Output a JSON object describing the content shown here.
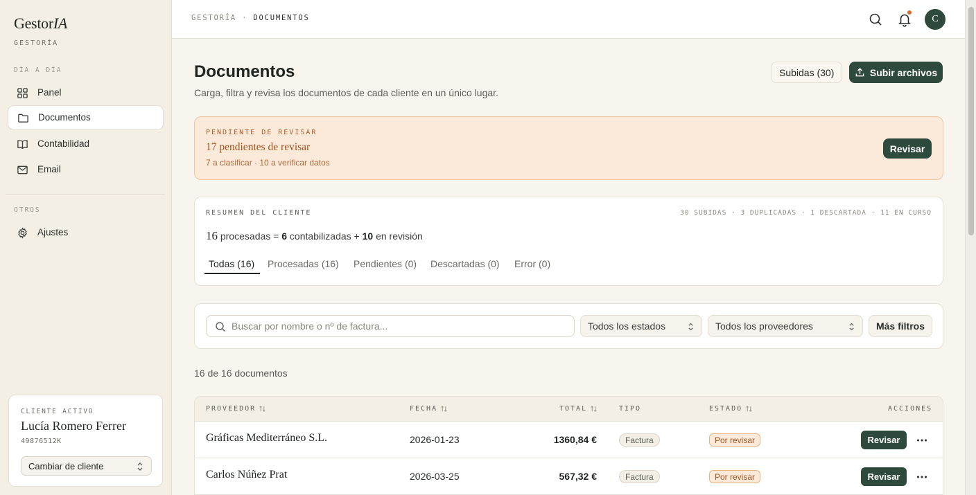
{
  "sidebar": {
    "brand_main": "Gestor",
    "brand_italic": "IA",
    "brand_sub": "GESTORÍA",
    "section_day": "DÍA A DÍA",
    "section_others": "OTROS",
    "items": [
      {
        "label": "Panel",
        "icon": "grid-icon"
      },
      {
        "label": "Documentos",
        "icon": "folder-icon",
        "active": true
      },
      {
        "label": "Contabilidad",
        "icon": "book-icon"
      },
      {
        "label": "Email",
        "icon": "mail-icon"
      },
      {
        "label": "Ajustes",
        "icon": "gear-icon"
      }
    ],
    "client": {
      "label": "CLIENTE ACTIVO",
      "name": "Lucía Romero Ferrer",
      "nif": "49876512K",
      "switch_label": "Cambiar de cliente"
    }
  },
  "topbar": {
    "crumb_root": "GESTORÍA",
    "crumb_sep": " · ",
    "crumb_current": "DOCUMENTOS",
    "avatar_initial": "C"
  },
  "header": {
    "title": "Documentos",
    "description": "Carga, filtra y revisa los documentos de cada cliente en un único lugar.",
    "uploads_button": "Subidas (30)",
    "upload_button": "Subir archivos"
  },
  "alert": {
    "label": "PENDIENTE DE REVISAR",
    "title": "17 pendientes de revisar",
    "subtitle": "7 a clasificar · 10 a verificar datos",
    "button": "Revisar"
  },
  "summary": {
    "label": "RESUMEN DEL CLIENTE",
    "stats": "30 SUBIDAS · 3 DUPLICADAS · 1 DESCARTADA · 11 EN CURSO",
    "processed": "16",
    "processed_text": " procesadas = ",
    "booked": "6",
    "booked_text": " contabilizadas + ",
    "review": "10",
    "review_text": " en revisión",
    "tabs": [
      "Todas (16)",
      "Procesadas (16)",
      "Pendientes (0)",
      "Descartadas (0)",
      "Error (0)"
    ]
  },
  "filters": {
    "search_placeholder": "Buscar por nombre o nº de factura...",
    "state_select": "Todos los estados",
    "provider_select": "Todos los proveedores",
    "more_button": "Más filtros"
  },
  "count_text": "16 de 16 documentos",
  "table": {
    "columns": {
      "provider": "PROVEEDOR",
      "date": "FECHA",
      "total": "TOTAL",
      "type": "TIPO",
      "state": "ESTADO",
      "actions": "ACCIONES"
    },
    "rows": [
      {
        "provider": "Gráficas Mediterráneo S.L.",
        "date": "2026-01-23",
        "total": "1360,84 €",
        "type": "Factura",
        "state": "Por revisar",
        "action": "Revisar"
      },
      {
        "provider": "Carlos Núñez Prat",
        "date": "2026-03-25",
        "total": "567,32 €",
        "type": "Factura",
        "state": "Por revisar",
        "action": "Revisar"
      }
    ]
  },
  "colors": {
    "accent": "#2e4a3c",
    "warning_bg": "#fbe9da",
    "warning_text": "#a5521c",
    "notification": "#d66a2f"
  }
}
